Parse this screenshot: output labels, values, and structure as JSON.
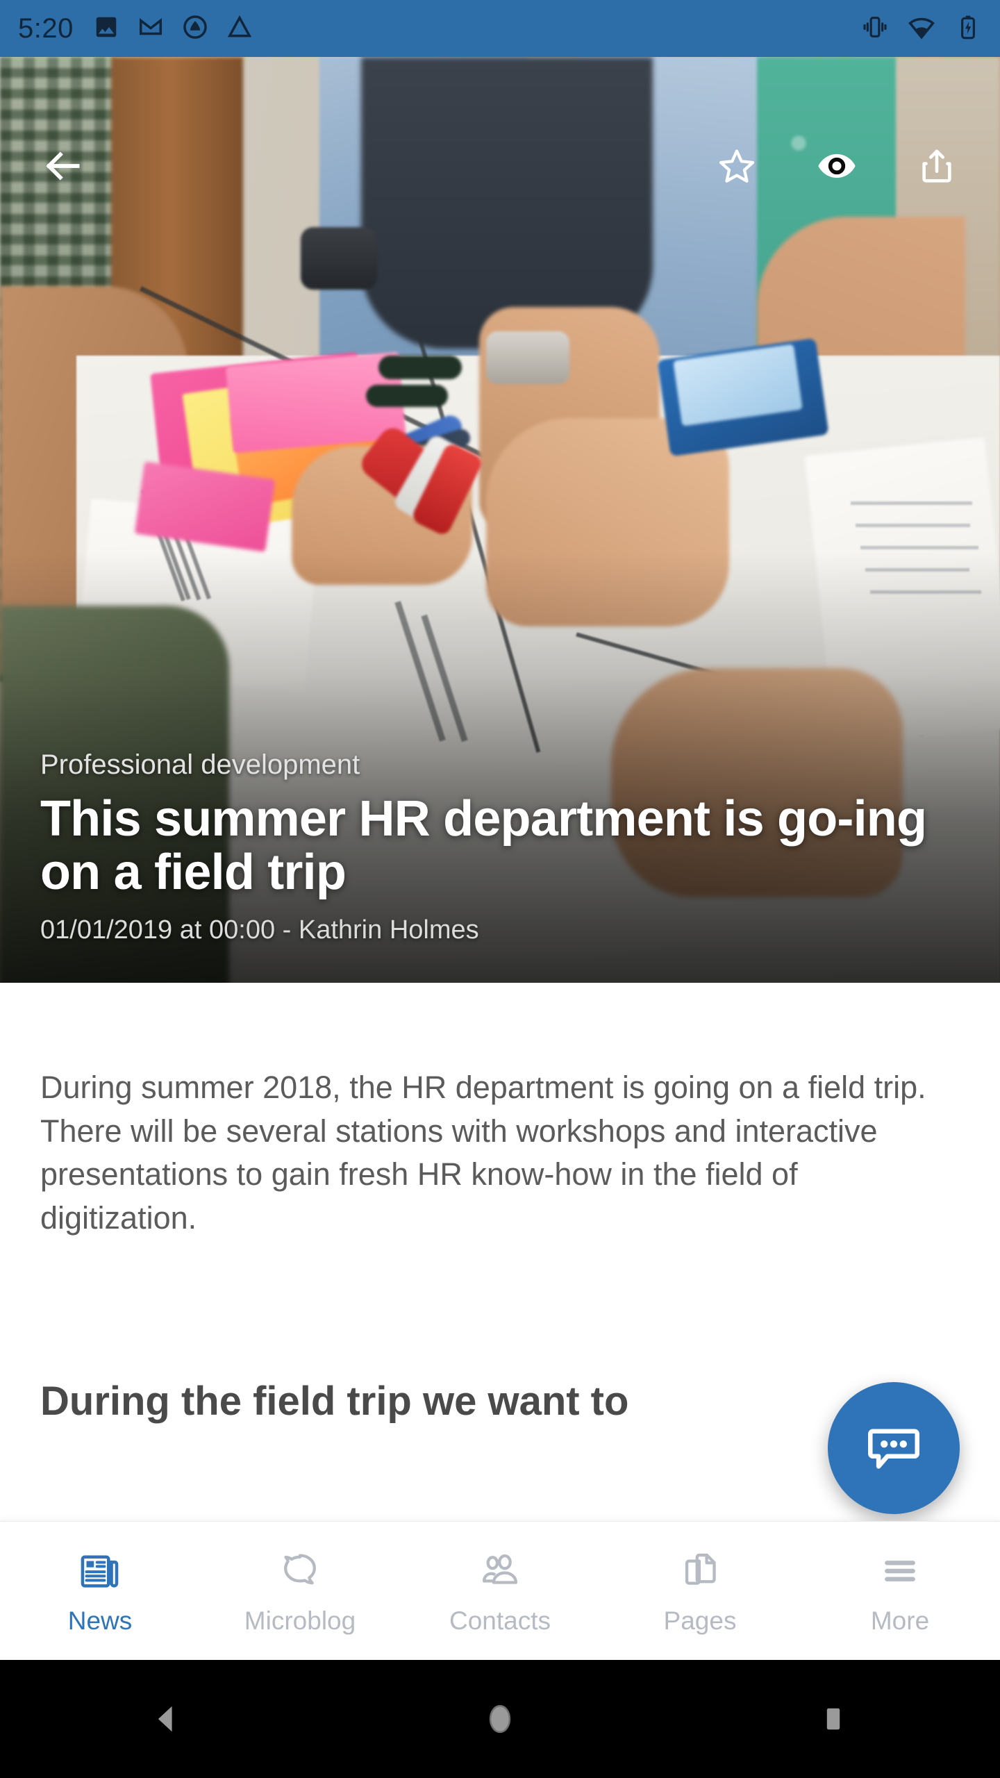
{
  "statusbar": {
    "time": "5:20",
    "left_icons": [
      "photos-icon",
      "gmail-icon",
      "compass-icon",
      "drive-icon"
    ],
    "right_icons": [
      "vibrate-icon",
      "wifi-icon",
      "battery-charging-icon"
    ],
    "background_color": "#2D6DA8"
  },
  "appbar": {
    "back_label": "back-arrow-icon",
    "actions": [
      {
        "name": "favorite-star-icon",
        "state": "outline"
      },
      {
        "name": "view-eye-icon",
        "state": "filled"
      },
      {
        "name": "share-icon",
        "state": "outline"
      }
    ]
  },
  "article": {
    "category": "Professional development",
    "headline": "This summer HR department is go-ing on a field trip",
    "headline_line1": "This summer HR department is go-",
    "headline_line2": "ing on a field trip",
    "date": "01/01/2019 at 00:00",
    "separator": "-",
    "author": "Kathrin Holmes",
    "byline": "01/01/2019 at 00:00 -  Kathrin Holmes",
    "body": "During summer 2018, the HR department is going on a field trip. There will be several stations with workshops and interactive presentations to gain fresh HR know-how in the field of digitization.",
    "subheading": "During the field trip we want to"
  },
  "fab": {
    "icon": "comment-bubble-icon",
    "color": "#2F74B8"
  },
  "bottom_nav": {
    "active_color": "#2F74B8",
    "inactive_color": "#b6bac2",
    "items": [
      {
        "label": "News",
        "icon": "newspaper-icon",
        "active": true
      },
      {
        "label": "Microblog",
        "icon": "speech-bubble-icon",
        "active": false
      },
      {
        "label": "Contacts",
        "icon": "people-icon",
        "active": false
      },
      {
        "label": "Pages",
        "icon": "documents-icon",
        "active": false
      },
      {
        "label": "More",
        "icon": "hamburger-icon",
        "active": false
      }
    ]
  },
  "android_nav": {
    "buttons": [
      "back-triangle-icon",
      "home-circle-icon",
      "recents-square-icon"
    ]
  }
}
